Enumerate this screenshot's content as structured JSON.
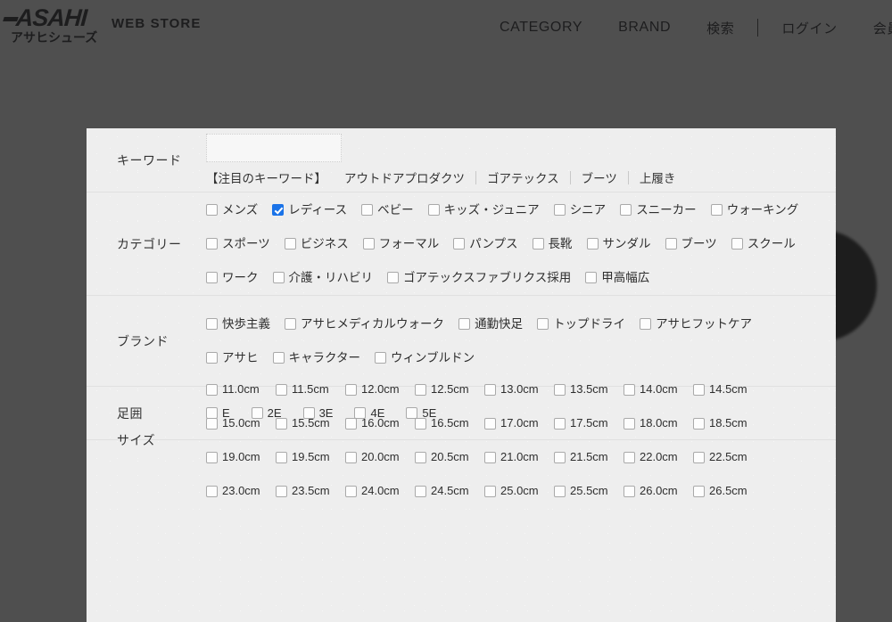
{
  "site": {
    "logo_word": "ASAHI",
    "logo_kana": "アサヒシューズ",
    "store_label": "WEB STORE"
  },
  "nav": {
    "items": [
      {
        "label": "CATEGORY",
        "jp": false
      },
      {
        "label": "BRAND",
        "jp": false
      },
      {
        "label": "検索",
        "jp": true
      }
    ],
    "account_items": [
      {
        "label": "ログイン"
      },
      {
        "label": "会員登録"
      }
    ]
  },
  "modal": {
    "keyword": {
      "label": "キーワード",
      "value": "",
      "placeholder": "",
      "featured_title": "【注目のキーワード】",
      "featured_items": [
        "アウトドアプロダクツ",
        "ゴアテックス",
        "ブーツ",
        "上履き"
      ]
    },
    "category": {
      "label": "カテゴリー",
      "rows": [
        [
          {
            "label": "メンズ",
            "checked": false
          },
          {
            "label": "レディース",
            "checked": true
          },
          {
            "label": "ベビー",
            "checked": false
          },
          {
            "label": "キッズ・ジュニア",
            "checked": false
          },
          {
            "label": "シニア",
            "checked": false
          },
          {
            "label": "スニーカー",
            "checked": false
          },
          {
            "label": "ウォーキング",
            "checked": false
          }
        ],
        [
          {
            "label": "スポーツ",
            "checked": false
          },
          {
            "label": "ビジネス",
            "checked": false
          },
          {
            "label": "フォーマル",
            "checked": false
          },
          {
            "label": "パンプス",
            "checked": false
          },
          {
            "label": "長靴",
            "checked": false
          },
          {
            "label": "サンダル",
            "checked": false
          },
          {
            "label": "ブーツ",
            "checked": false
          },
          {
            "label": "スクール",
            "checked": false
          }
        ],
        [
          {
            "label": "ワーク",
            "checked": false
          },
          {
            "label": "介護・リハビリ",
            "checked": false
          },
          {
            "label": "ゴアテックスファブリクス採用",
            "checked": false
          },
          {
            "label": "甲高幅広",
            "checked": false
          }
        ]
      ]
    },
    "brand": {
      "label": "ブランド",
      "rows": [
        [
          {
            "label": "快歩主義",
            "checked": false
          },
          {
            "label": "アサヒメディカルウォーク",
            "checked": false
          },
          {
            "label": "通勤快足",
            "checked": false
          },
          {
            "label": "トップドライ",
            "checked": false
          },
          {
            "label": "アサヒフットケア",
            "checked": false
          }
        ],
        [
          {
            "label": "アサヒ",
            "checked": false
          },
          {
            "label": "キャラクター",
            "checked": false
          },
          {
            "label": "ウィンブルドン",
            "checked": false
          }
        ]
      ]
    },
    "width": {
      "label": "足囲",
      "rows": [
        [
          {
            "label": "E",
            "checked": false
          },
          {
            "label": "2E",
            "checked": false
          },
          {
            "label": "3E",
            "checked": false
          },
          {
            "label": "4E",
            "checked": false
          },
          {
            "label": "5E",
            "checked": false
          }
        ]
      ]
    },
    "size": {
      "label": "サイズ",
      "rows": [
        [
          {
            "label": "11.0cm",
            "checked": false
          },
          {
            "label": "11.5cm",
            "checked": false
          },
          {
            "label": "12.0cm",
            "checked": false
          },
          {
            "label": "12.5cm",
            "checked": false
          },
          {
            "label": "13.0cm",
            "checked": false
          },
          {
            "label": "13.5cm",
            "checked": false
          },
          {
            "label": "14.0cm",
            "checked": false
          },
          {
            "label": "14.5cm",
            "checked": false
          }
        ],
        [
          {
            "label": "15.0cm",
            "checked": false
          },
          {
            "label": "15.5cm",
            "checked": false
          },
          {
            "label": "16.0cm",
            "checked": false
          },
          {
            "label": "16.5cm",
            "checked": false
          },
          {
            "label": "17.0cm",
            "checked": false
          },
          {
            "label": "17.5cm",
            "checked": false
          },
          {
            "label": "18.0cm",
            "checked": false
          },
          {
            "label": "18.5cm",
            "checked": false
          }
        ],
        [
          {
            "label": "19.0cm",
            "checked": false
          },
          {
            "label": "19.5cm",
            "checked": false
          },
          {
            "label": "20.0cm",
            "checked": false
          },
          {
            "label": "20.5cm",
            "checked": false
          },
          {
            "label": "21.0cm",
            "checked": false
          },
          {
            "label": "21.5cm",
            "checked": false
          },
          {
            "label": "22.0cm",
            "checked": false
          },
          {
            "label": "22.5cm",
            "checked": false
          }
        ],
        [
          {
            "label": "23.0cm",
            "checked": false
          },
          {
            "label": "23.5cm",
            "checked": false
          },
          {
            "label": "24.0cm",
            "checked": false
          },
          {
            "label": "24.5cm",
            "checked": false
          },
          {
            "label": "25.0cm",
            "checked": false
          },
          {
            "label": "25.5cm",
            "checked": false
          },
          {
            "label": "26.0cm",
            "checked": false
          },
          {
            "label": "26.5cm",
            "checked": false
          }
        ]
      ]
    }
  },
  "colors": {
    "overlay": "#434343",
    "modal_bg": "#eeeeee",
    "checkbox_checked": "#1a73e8",
    "text": "#2e2e2e"
  }
}
